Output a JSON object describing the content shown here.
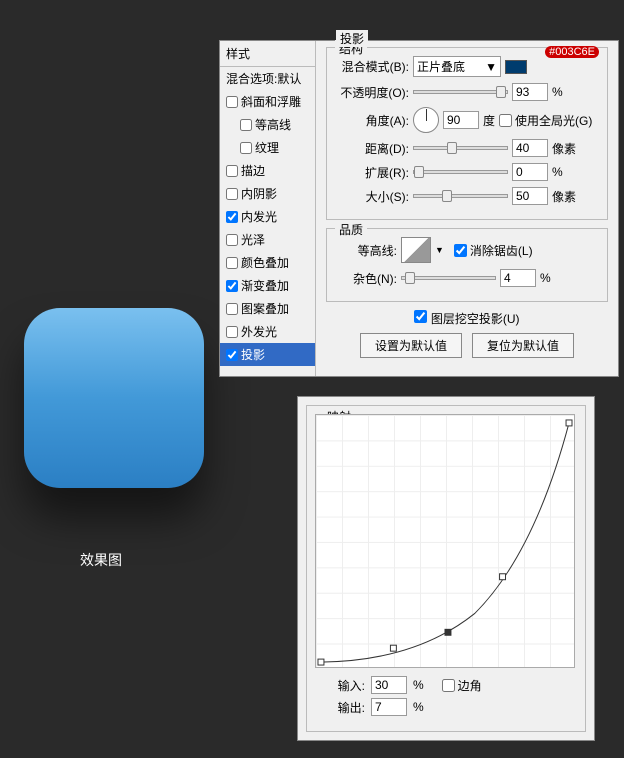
{
  "preview": {
    "label": "效果图"
  },
  "styles": {
    "header": "样式",
    "blending": "混合选项:默认",
    "items": [
      {
        "label": "斜面和浮雕",
        "checked": false
      },
      {
        "label": "等高线",
        "checked": false,
        "sub": true
      },
      {
        "label": "纹理",
        "checked": false,
        "sub": true
      },
      {
        "label": "描边",
        "checked": false
      },
      {
        "label": "内阴影",
        "checked": false
      },
      {
        "label": "内发光",
        "checked": true
      },
      {
        "label": "光泽",
        "checked": false
      },
      {
        "label": "颜色叠加",
        "checked": false
      },
      {
        "label": "渐变叠加",
        "checked": true
      },
      {
        "label": "图案叠加",
        "checked": false
      },
      {
        "label": "外发光",
        "checked": false
      },
      {
        "label": "投影",
        "checked": true,
        "selected": true
      }
    ]
  },
  "shadow": {
    "title": "投影",
    "structure": {
      "legend": "结构",
      "blendModeLabel": "混合模式(B):",
      "blendModeValue": "正片叠底",
      "colorCode": "#003C6E",
      "opacityLabel": "不透明度(O):",
      "opacityValue": "93",
      "pct": "%",
      "angleLabel": "角度(A):",
      "angleValue": "90",
      "angleUnit": "度",
      "globalLight": "使用全局光(G)",
      "distanceLabel": "距离(D):",
      "distanceValue": "40",
      "px": "像素",
      "spreadLabel": "扩展(R):",
      "spreadValue": "0",
      "sizeLabel": "大小(S):",
      "sizeValue": "50"
    },
    "quality": {
      "legend": "品质",
      "contourLabel": "等高线:",
      "antialias": "消除锯齿(L)",
      "noiseLabel": "杂色(N):",
      "noiseValue": "4"
    },
    "knockout": "图层挖空投影(U)",
    "setDefault": "设置为默认值",
    "resetDefault": "复位为默认值"
  },
  "curve": {
    "title": "映射",
    "inputLabel": "输入:",
    "inputValue": "30",
    "outputLabel": "输出:",
    "outputValue": "7",
    "pct": "%",
    "corner": "边角"
  }
}
